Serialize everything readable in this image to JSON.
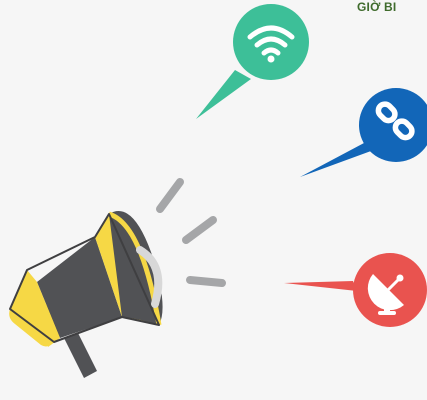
{
  "header": {
    "partial_title": "GIỜ BI"
  },
  "colors": {
    "background": "#f6f6f6",
    "text": "#3f6b2c",
    "wifi_bubble": "#3dbf98",
    "link_bubble": "#1266b8",
    "satellite_bubble": "#e9534f",
    "megaphone_yellow": "#f6d845",
    "megaphone_dark": "#515255",
    "sound_lines": "#a5a6a8"
  },
  "icons": {
    "wifi": "wifi-icon",
    "link": "link-icon",
    "satellite": "satellite-dish-icon",
    "megaphone": "megaphone-icon"
  }
}
